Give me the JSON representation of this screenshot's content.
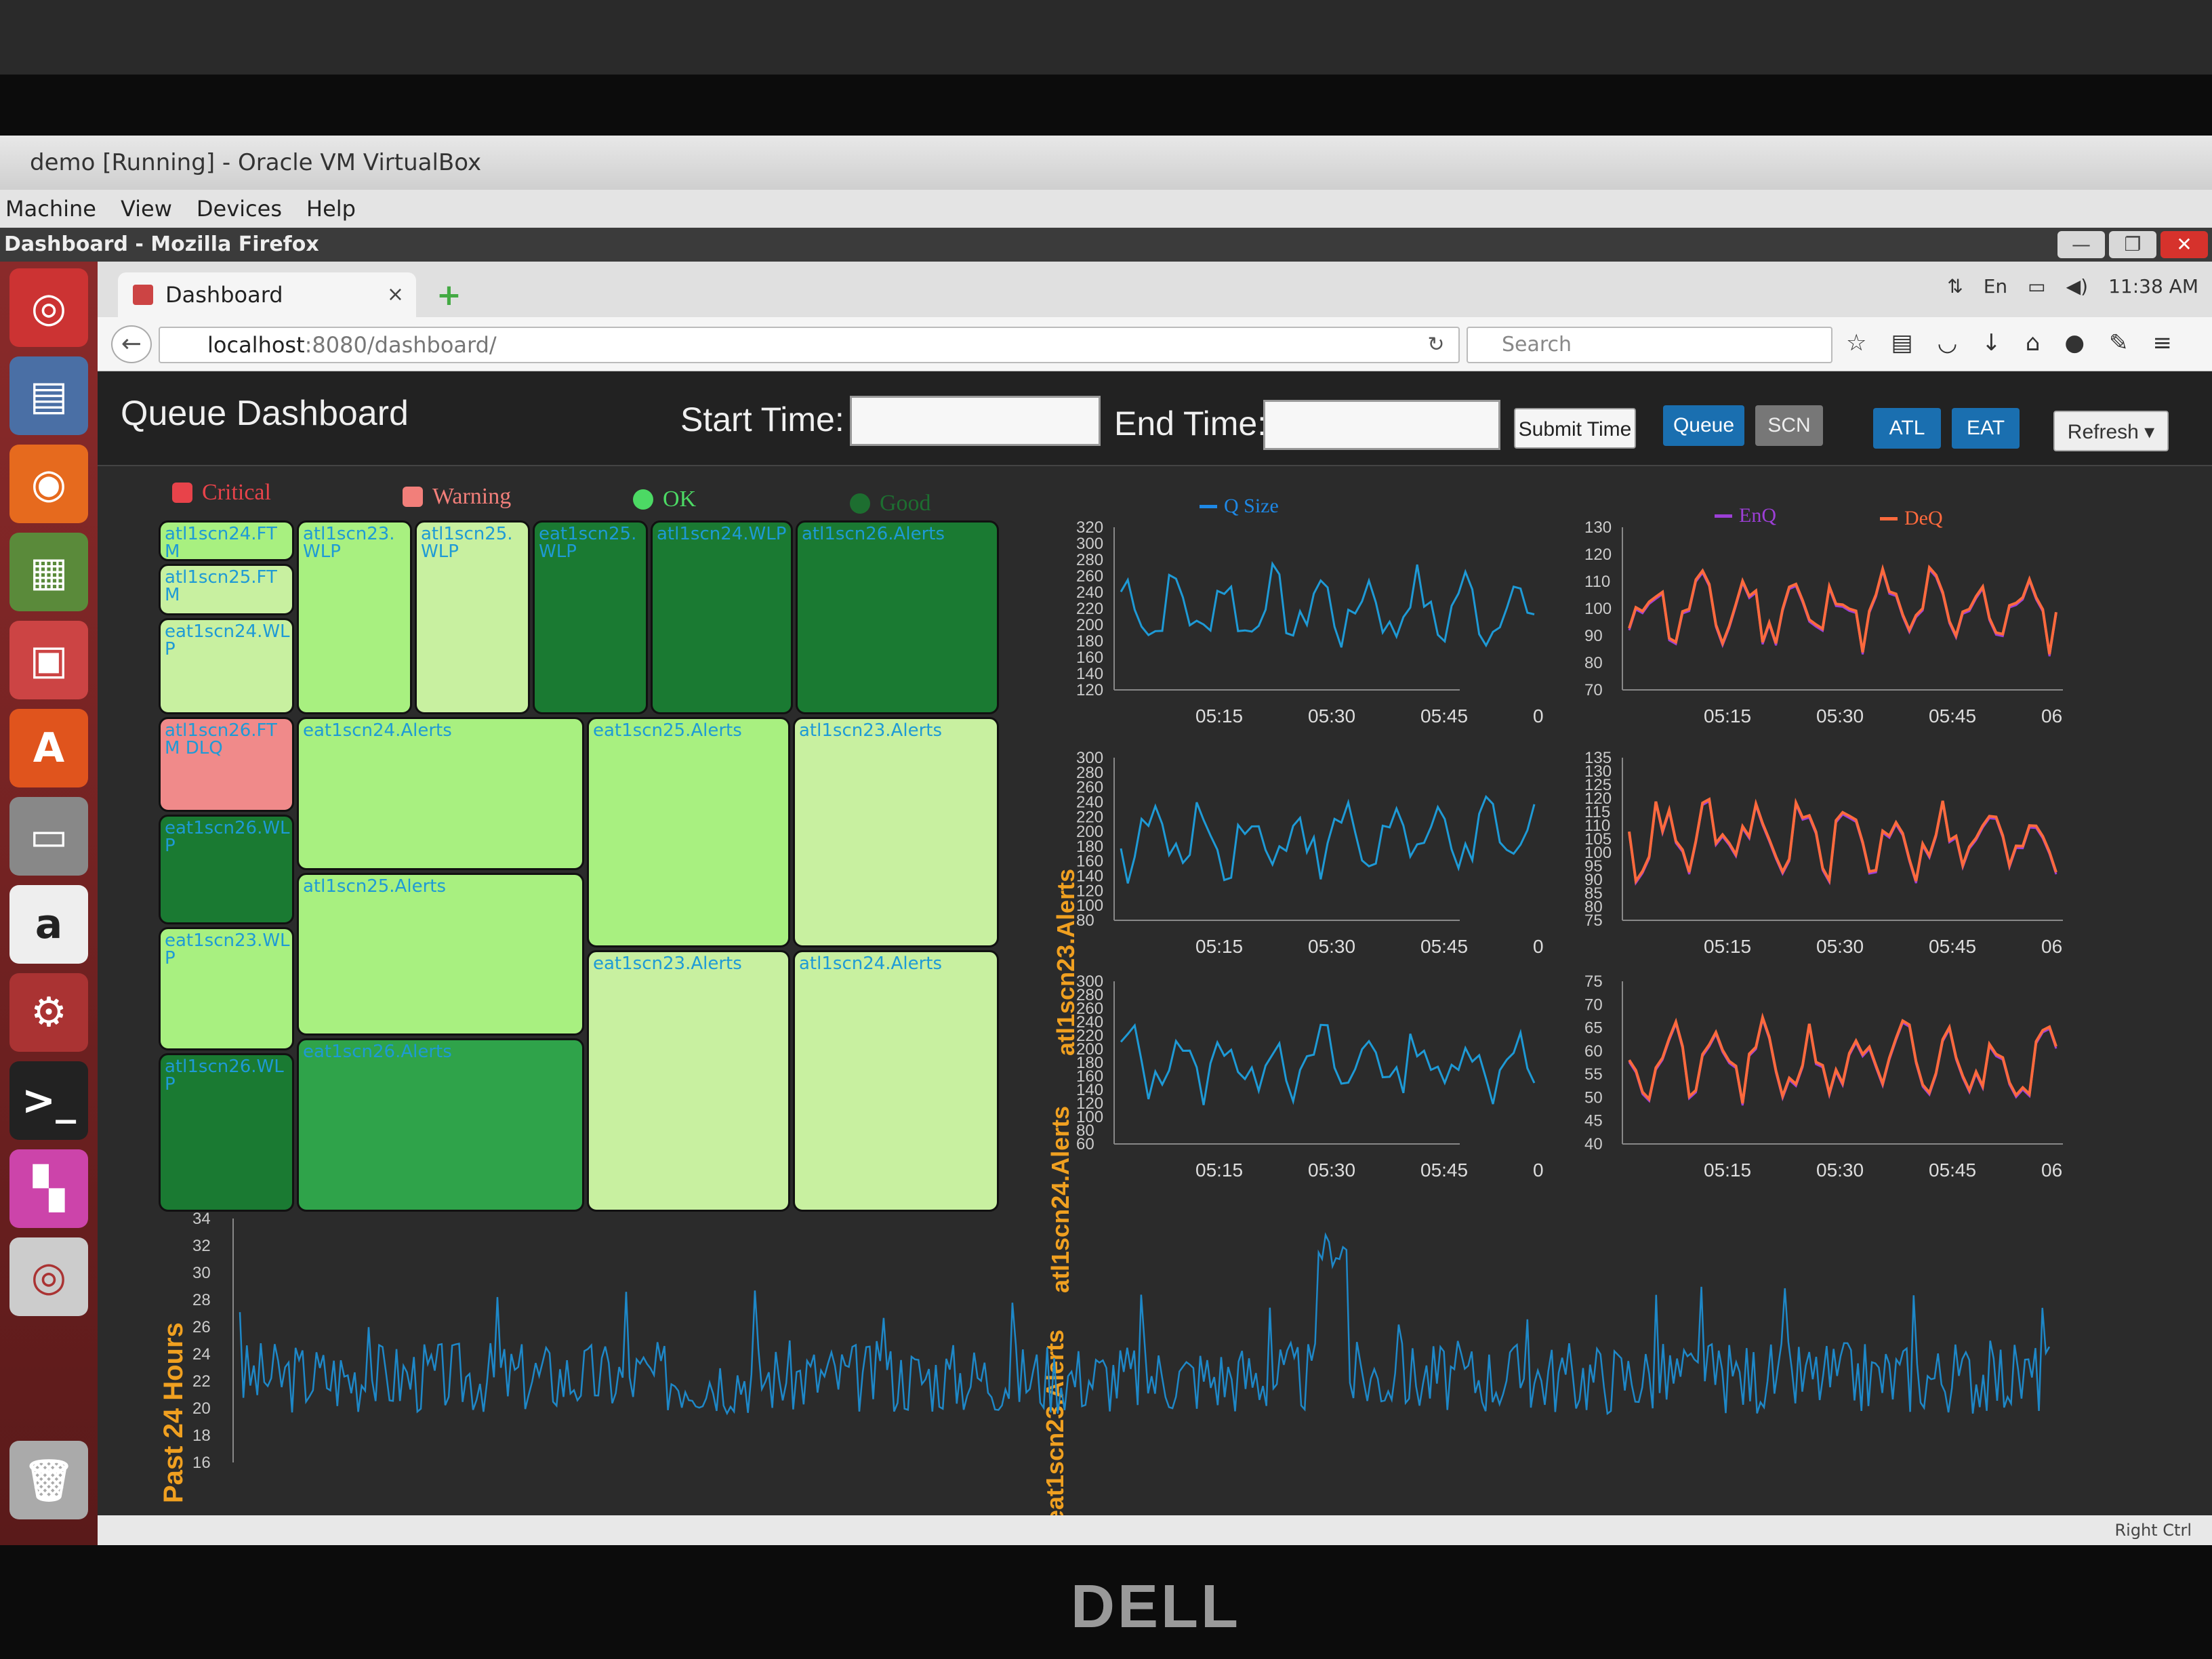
{
  "window": {
    "vbox_title": "demo [Running] - Oracle VM VirtualBox",
    "vbox_menu": [
      "Machine",
      "View",
      "Devices",
      "Help"
    ],
    "firefox_title": "Dashboard - Mozilla Firefox",
    "controls": [
      "—",
      "❐",
      "✕"
    ]
  },
  "browser": {
    "tab_title": "Dashboard",
    "tab_close": "×",
    "new_tab": "+",
    "url_host": "localhost",
    "url_path": ":8080/dashboard/",
    "search_placeholder": "Search",
    "system": {
      "kbd": "En",
      "clock": "11:38 AM"
    }
  },
  "header": {
    "title": "Queue Dashboard",
    "start_label": "Start Time:",
    "end_label": "End Time:",
    "submit": "Submit Time",
    "queue_btn": "Queue",
    "scn_btn": "SCN",
    "atl_btn": "ATL",
    "eat_btn": "EAT",
    "refresh_btn": "Refresh ▾"
  },
  "legend": [
    {
      "label": "Critical",
      "color": "#e8434a"
    },
    {
      "label": "Warning",
      "color": "#f27f7a"
    },
    {
      "label": "OK",
      "color": "#4cd964"
    },
    {
      "label": "Good",
      "color": "#1d6e30"
    }
  ],
  "treemap": [
    {
      "label": "atl1scn24.FTM",
      "cls": "light"
    },
    {
      "label": "atl1scn25.FTM",
      "cls": "pale"
    },
    {
      "label": "eat1scn24.WLP",
      "cls": "pale"
    },
    {
      "label": "atl1scn26.FTM DLQ",
      "cls": "pink"
    },
    {
      "label": "eat1scn26.WLP",
      "cls": "dark"
    },
    {
      "label": "eat1scn23.WLP",
      "cls": "light"
    },
    {
      "label": "atl1scn26.WLP",
      "cls": "dark"
    },
    {
      "label": "atl1scn23.WLP",
      "cls": "light"
    },
    {
      "label": "atl1scn25.WLP",
      "cls": "pale"
    },
    {
      "label": "eat1scn25.WLP",
      "cls": "dark"
    },
    {
      "label": "atl1scn24.WLP",
      "cls": "dark"
    },
    {
      "label": "atl1scn26.Alerts",
      "cls": "dark"
    },
    {
      "label": "eat1scn24.Alerts",
      "cls": "light"
    },
    {
      "label": "atl1scn25.Alerts",
      "cls": "light"
    },
    {
      "label": "eat1scn26.Alerts",
      "cls": "mid"
    },
    {
      "label": "eat1scn25.Alerts",
      "cls": "light"
    },
    {
      "label": "atl1scn23.Alerts",
      "cls": "pale"
    },
    {
      "label": "eat1scn23.Alerts",
      "cls": "pale"
    },
    {
      "label": "atl1scn24.Alerts",
      "cls": "pale"
    }
  ],
  "charts": {
    "qsize_legend": "Q Size",
    "enq_legend": "EnQ",
    "deq_legend": "DeQ",
    "rows": [
      {
        "name": "atl1scn23.Alerts",
        "left_ticks": [
          "320",
          "300",
          "280",
          "260",
          "240",
          "220",
          "200",
          "180",
          "160",
          "140",
          "120"
        ],
        "left_x": [
          "05:15",
          "05:30",
          "05:45",
          "0"
        ],
        "right_ticks": [
          "130",
          "120",
          "110",
          "100",
          "90",
          "80",
          "70"
        ],
        "right_x": [
          "05:15",
          "05:30",
          "05:45",
          "06"
        ]
      },
      {
        "name": "atl1scn24.Alerts",
        "left_ticks": [
          "300",
          "280",
          "260",
          "240",
          "220",
          "200",
          "180",
          "160",
          "140",
          "120",
          "100",
          "80"
        ],
        "left_x": [
          "05:15",
          "05:30",
          "05:45",
          "0"
        ],
        "right_ticks": [
          "135",
          "130",
          "125",
          "120",
          "115",
          "110",
          "105",
          "100",
          "95",
          "90",
          "85",
          "80",
          "75"
        ],
        "right_x": [
          "05:15",
          "05:30",
          "05:45",
          "06"
        ]
      },
      {
        "name": "eat1scn23.Alerts",
        "left_ticks": [
          "300",
          "280",
          "260",
          "240",
          "220",
          "200",
          "180",
          "160",
          "140",
          "120",
          "100",
          "80",
          "60"
        ],
        "left_x": [
          "05:15",
          "05:30",
          "05:45",
          "0"
        ],
        "right_ticks": [
          "75",
          "70",
          "65",
          "60",
          "55",
          "50",
          "45",
          "40"
        ],
        "right_x": [
          "05:15",
          "05:30",
          "05:45",
          "06"
        ]
      }
    ],
    "past": {
      "label": "Past 24 Hours",
      "ticks": [
        "34",
        "32",
        "30",
        "28",
        "26",
        "24",
        "22",
        "20",
        "18",
        "16"
      ]
    }
  },
  "statusbar": "Right Ctrl",
  "brand": "DELL"
}
